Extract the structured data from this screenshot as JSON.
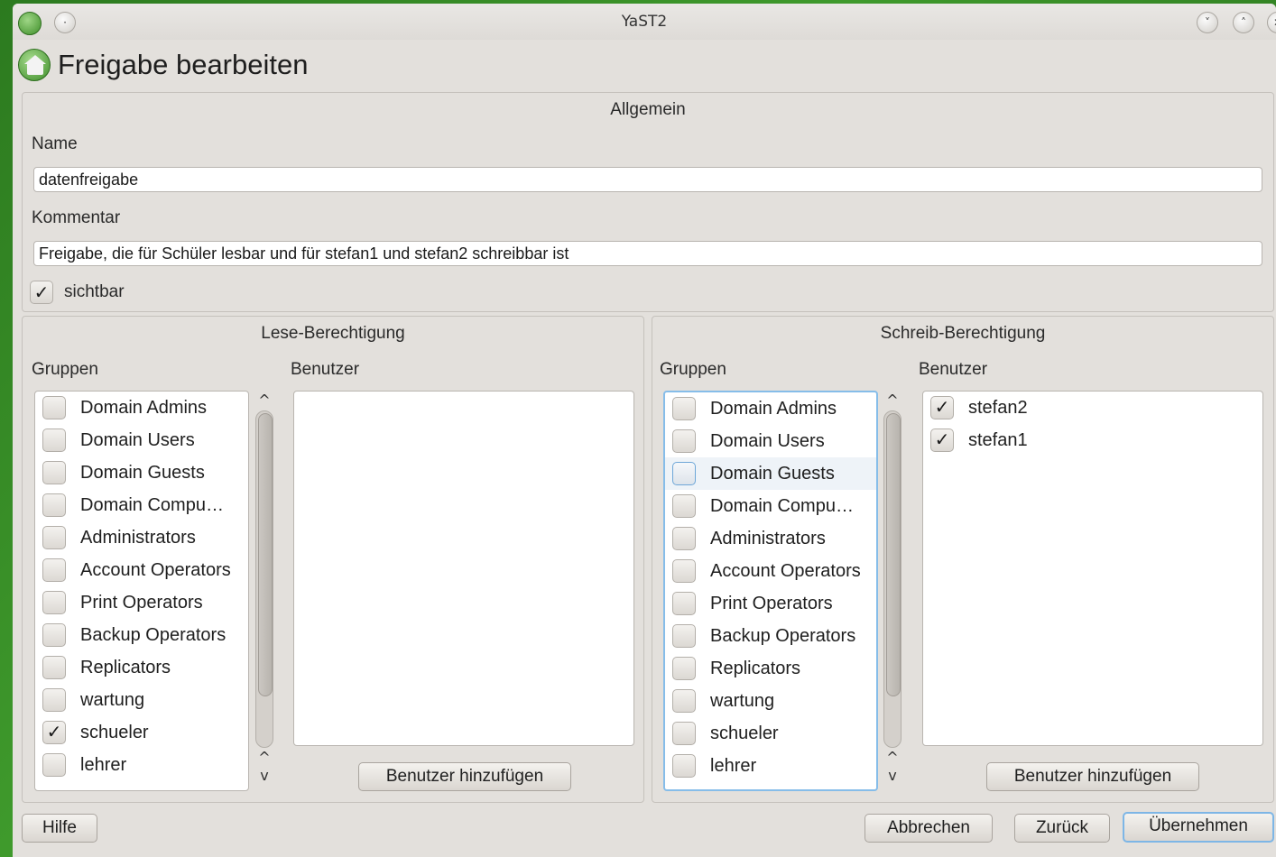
{
  "window": {
    "title": "YaST2",
    "heading": "Freigabe bearbeiten"
  },
  "general": {
    "frame_title": "Allgemein",
    "name_label": "Name",
    "name_value": "datenfreigabe",
    "comment_label": "Kommentar",
    "comment_value": "Freigabe, die für Schüler lesbar und für stefan1 und stefan2 schreibbar ist",
    "visible_label": "sichtbar",
    "visible_checked": true
  },
  "read": {
    "frame_title": "Lese-Berechtigung",
    "groups_label": "Gruppen",
    "users_label": "Benutzer",
    "groups": [
      {
        "label": "Domain Admins",
        "checked": false
      },
      {
        "label": "Domain Users",
        "checked": false
      },
      {
        "label": "Domain Guests",
        "checked": false
      },
      {
        "label": "Domain Compu…",
        "checked": false
      },
      {
        "label": "Administrators",
        "checked": false
      },
      {
        "label": "Account Operators",
        "checked": false
      },
      {
        "label": "Print Operators",
        "checked": false
      },
      {
        "label": "Backup Operators",
        "checked": false
      },
      {
        "label": "Replicators",
        "checked": false
      },
      {
        "label": "wartung",
        "checked": false
      },
      {
        "label": "schueler",
        "checked": true
      },
      {
        "label": "lehrer",
        "checked": false
      }
    ],
    "users": [],
    "add_user_button": "Benutzer hinzufügen"
  },
  "write": {
    "frame_title": "Schreib-Berechtigung",
    "groups_label": "Gruppen",
    "users_label": "Benutzer",
    "groups": [
      {
        "label": "Domain Admins",
        "checked": false
      },
      {
        "label": "Domain Users",
        "checked": false
      },
      {
        "label": "Domain Guests",
        "checked": false
      },
      {
        "label": "Domain Compu…",
        "checked": false
      },
      {
        "label": "Administrators",
        "checked": false
      },
      {
        "label": "Account Operators",
        "checked": false
      },
      {
        "label": "Print Operators",
        "checked": false
      },
      {
        "label": "Backup Operators",
        "checked": false
      },
      {
        "label": "Replicators",
        "checked": false
      },
      {
        "label": "wartung",
        "checked": false
      },
      {
        "label": "schueler",
        "checked": false
      },
      {
        "label": "lehrer",
        "checked": false
      }
    ],
    "users": [
      {
        "label": "stefan2",
        "checked": true
      },
      {
        "label": "stefan1",
        "checked": true
      }
    ],
    "add_user_button": "Benutzer hinzufügen"
  },
  "footer": {
    "help": "Hilfe",
    "cancel": "Abbrechen",
    "back": "Zurück",
    "accept": "Übernehmen"
  },
  "icons": {
    "app_icon": "yast-house-icon",
    "check": "checkmark-icon"
  }
}
